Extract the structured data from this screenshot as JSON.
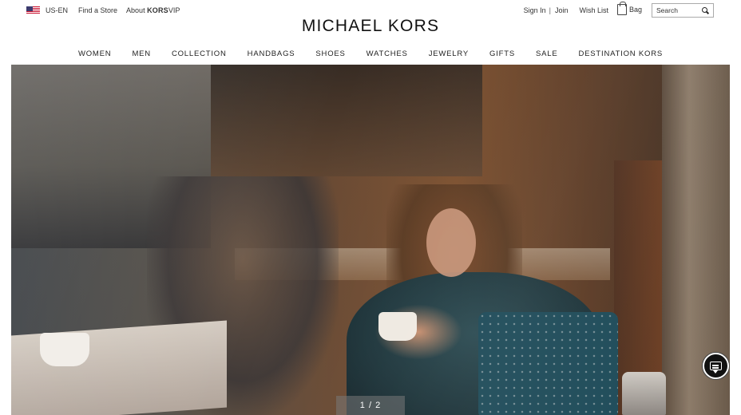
{
  "header": {
    "locale": "US-EN",
    "find_store": "Find a Store",
    "about_prefix": "About ",
    "about_brand": "KORS",
    "about_suffix": "VIP",
    "logo": "MICHAEL KORS",
    "sign_in": "Sign In",
    "separator": "|",
    "join": "Join",
    "wish_list": "Wish List",
    "bag": "Bag",
    "search_placeholder": "Search"
  },
  "nav": {
    "items": [
      {
        "label": "WOMEN"
      },
      {
        "label": "MEN"
      },
      {
        "label": "COLLECTION"
      },
      {
        "label": "HANDBAGS"
      },
      {
        "label": "SHOES"
      },
      {
        "label": "WATCHES"
      },
      {
        "label": "JEWELRY"
      },
      {
        "label": "GIFTS"
      },
      {
        "label": "SALE"
      },
      {
        "label": "DESTINATION KORS"
      }
    ]
  },
  "hero": {
    "pager": "1 / 2",
    "image_subject": "woman-with-coffee-in-diner-hero-image"
  },
  "icons": {
    "flag": "us-flag-icon",
    "bag": "shopping-bag-icon",
    "search": "search-icon",
    "chat": "chat-icon"
  },
  "colors": {
    "text": "#222222",
    "background": "#ffffff",
    "chat_button": "#111111"
  }
}
